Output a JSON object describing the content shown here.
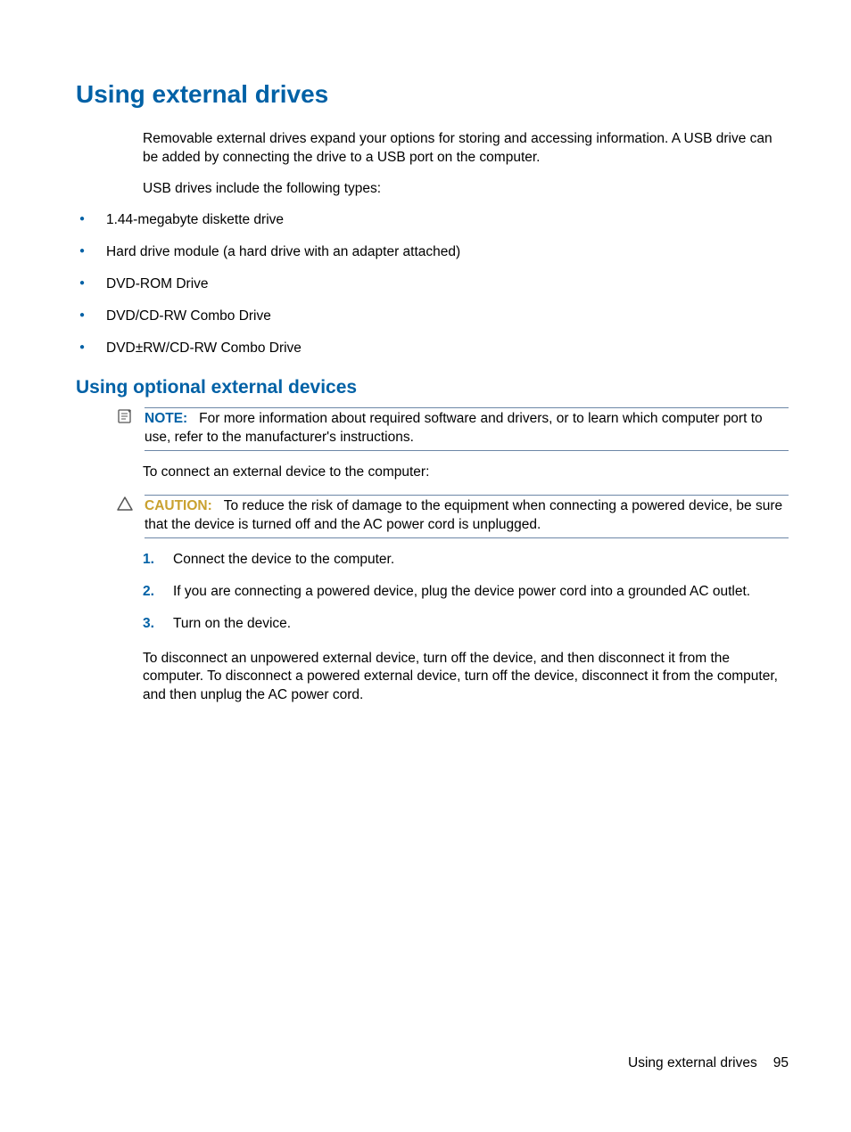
{
  "headings": {
    "h1": "Using external drives",
    "h2": "Using optional external devices"
  },
  "para1": "Removable external drives expand your options for storing and accessing information. A USB drive can be added by connecting the drive to a USB port on the computer.",
  "para2": "USB drives include the following types:",
  "bullets": [
    "1.44-megabyte diskette drive",
    "Hard drive module (a hard drive with an adapter attached)",
    "DVD-ROM Drive",
    "DVD/CD-RW Combo Drive",
    "DVD±RW/CD-RW Combo Drive"
  ],
  "note": {
    "label": "NOTE:",
    "text": "For more information about required software and drivers, or to learn which computer port to use, refer to the manufacturer's instructions."
  },
  "para3": "To connect an external device to the computer:",
  "caution": {
    "label": "CAUTION:",
    "text": "To reduce the risk of damage to the equipment when connecting a powered device, be sure that the device is turned off and the AC power cord is unplugged."
  },
  "steps": [
    "Connect the device to the computer.",
    "If you are connecting a powered device, plug the device power cord into a grounded AC outlet.",
    "Turn on the device."
  ],
  "para4": "To disconnect an unpowered external device, turn off the device, and then disconnect it from the computer. To disconnect a powered external device, turn off the device, disconnect it from the computer, and then unplug the AC power cord.",
  "footer": {
    "label": "Using external drives",
    "page": "95"
  }
}
